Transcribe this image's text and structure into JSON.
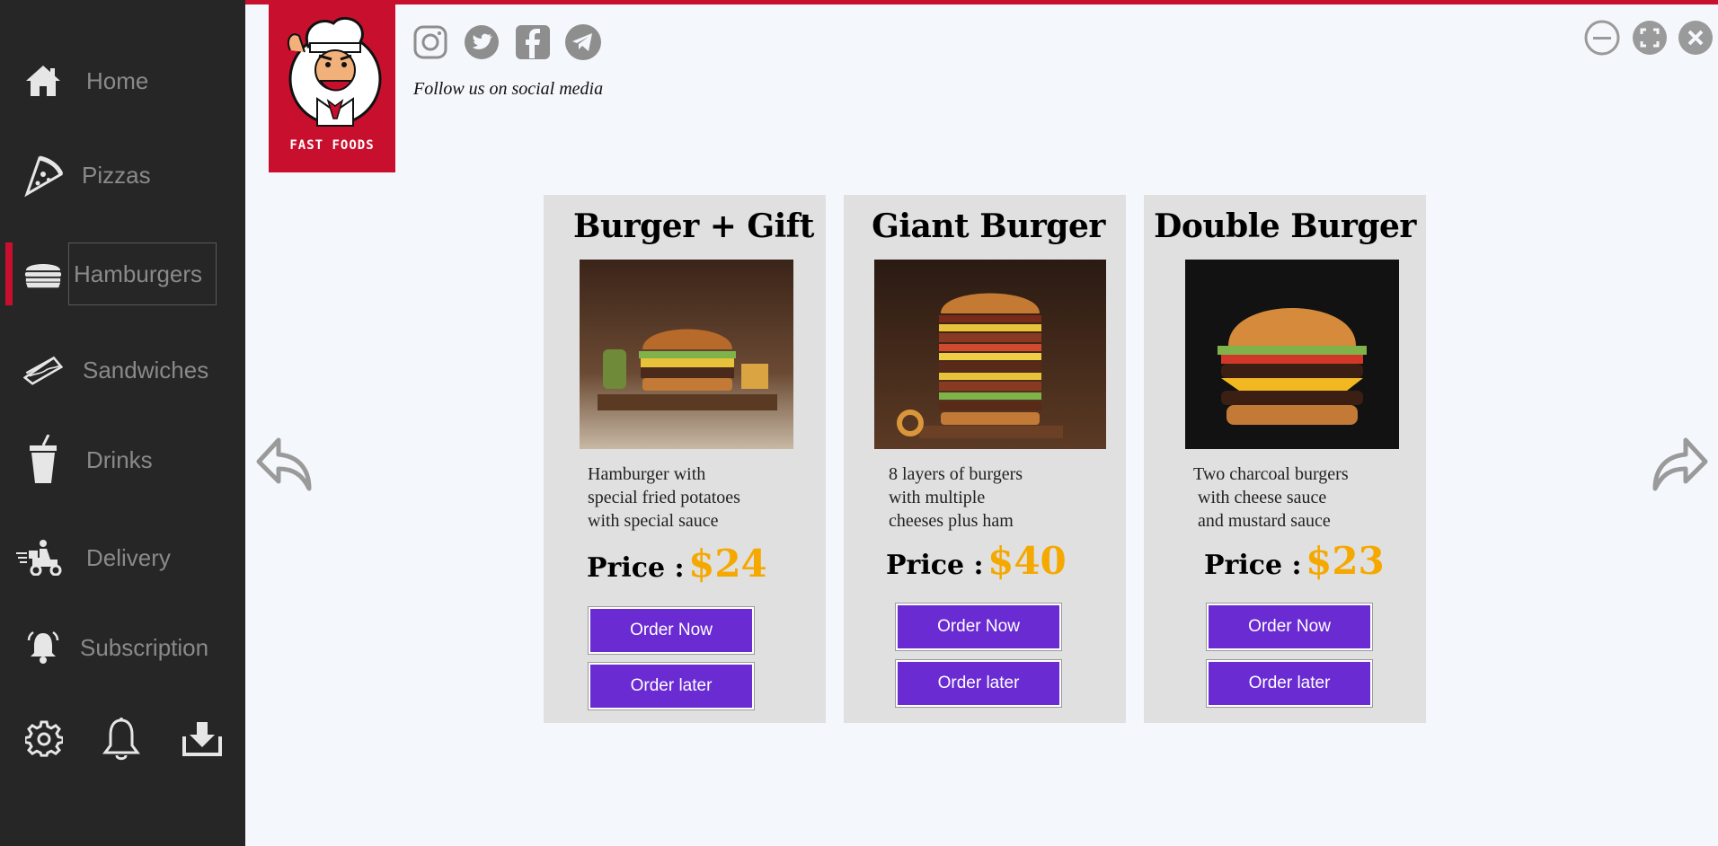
{
  "sidebar": {
    "items": [
      {
        "label": "Home",
        "icon": "home-icon"
      },
      {
        "label": "Pizzas",
        "icon": "pizza-icon"
      },
      {
        "label": "Hamburgers",
        "icon": "hamburger-icon",
        "active": true
      },
      {
        "label": "Sandwiches",
        "icon": "sandwich-icon"
      },
      {
        "label": "Drinks",
        "icon": "drink-icon"
      },
      {
        "label": "Delivery",
        "icon": "delivery-icon"
      },
      {
        "label": "Subscription",
        "icon": "subscription-bell-icon"
      }
    ],
    "bottom_icons": [
      "settings-gear-icon",
      "notification-bell-icon",
      "download-icon"
    ]
  },
  "header": {
    "brand": "FAST FOODS",
    "social_icons": [
      "instagram-icon",
      "twitter-icon",
      "facebook-icon",
      "telegram-icon"
    ],
    "follow_text": "Follow us on social media"
  },
  "window_controls": [
    "minimize-icon",
    "maximize-icon",
    "close-icon"
  ],
  "cards": [
    {
      "title": "Burger + Gift",
      "description": "Hamburger with\nspecial fried potatoes\nwith special sauce",
      "price_label": "Price :",
      "price": "$24",
      "order_now": "Order Now",
      "order_later": "Order later"
    },
    {
      "title": "Giant Burger",
      "description": "8 layers of burgers\nwith multiple\ncheeses plus ham",
      "price_label": "Price :",
      "price": "$40",
      "order_now": "Order Now",
      "order_later": "Order later"
    },
    {
      "title": "Double Burger",
      "description": "Two charcoal burgers\n with cheese sauce\n and mustard sauce",
      "price_label": "Price :",
      "price": "$23",
      "order_now": "Order Now",
      "order_later": "Order later"
    }
  ],
  "colors": {
    "accent_red": "#c8102e",
    "button_purple": "#6a2bd3",
    "price_gold": "#f5a800",
    "sidebar_bg": "#262626"
  }
}
